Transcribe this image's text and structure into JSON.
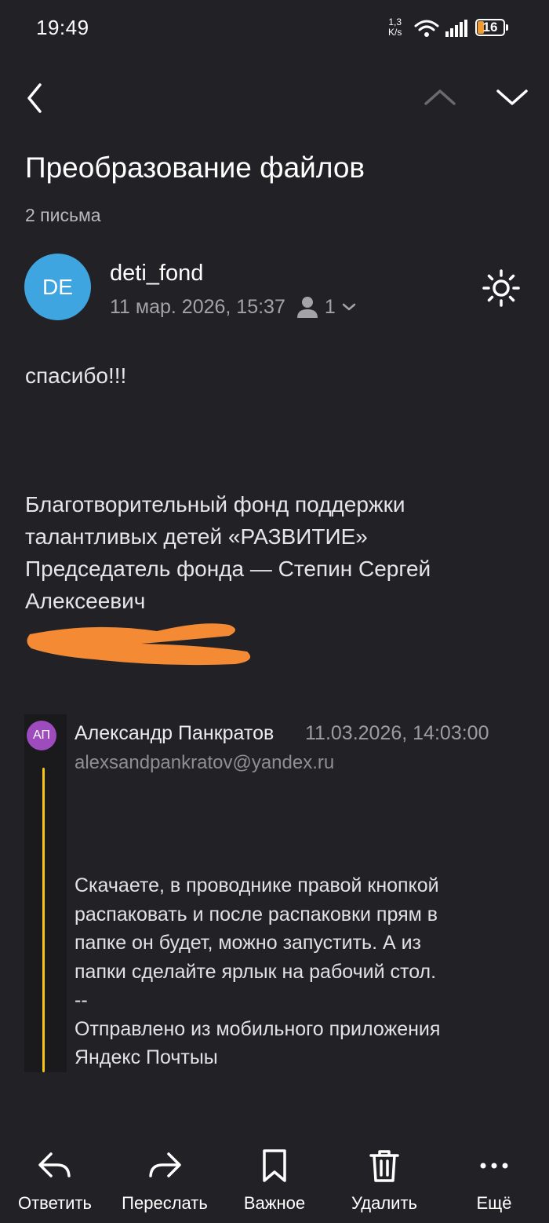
{
  "status": {
    "time": "19:49",
    "speed_value": "1,3",
    "speed_unit": "K/s",
    "battery": "16"
  },
  "nav": {
    "back_icon": "chevron-left-icon",
    "prev_icon": "chevron-up-icon",
    "next_icon": "chevron-down-icon"
  },
  "thread": {
    "title": "Преобразование файлов",
    "count_label": "2 письма"
  },
  "message": {
    "avatar_initials": "DE",
    "avatar_color": "#3fa5e0",
    "sender": "deti_fond",
    "date": "11 мар. 2026, 15:37",
    "recipients_count": "1",
    "body_greeting": "спасибо!!!",
    "signature_lines": [
      "Благотворительный  фонд поддержки",
      "талантливых детей «РАЗВИТИЕ»",
      "Председатель фонда — Степин Сергей",
      "Алексеевич"
    ]
  },
  "quoted": {
    "avatar_initials": "АП",
    "avatar_color": "#9d4bbd",
    "sender_name": "Александр Панкратов",
    "date": "11.03.2026, 14:03:00",
    "email": "alexsandpankratov@yandex.ru",
    "body_lines": [
      "Скачаете, в проводнике правой кнопкой",
      "распаковать и после распаковки прям в",
      "папке он будет, можно запустить. А из",
      "папки сделайте  ярлык на рабочий стол.",
      "--",
      "Отправлено из мобильного приложения",
      "Яндекс Почтыы"
    ]
  },
  "actions": {
    "reply": "Ответить",
    "forward": "Переслать",
    "important": "Важное",
    "delete": "Удалить",
    "more": "Ещё"
  },
  "colors": {
    "background": "#222226",
    "quote_accent": "#f5c518",
    "redaction": "#f58a35"
  }
}
